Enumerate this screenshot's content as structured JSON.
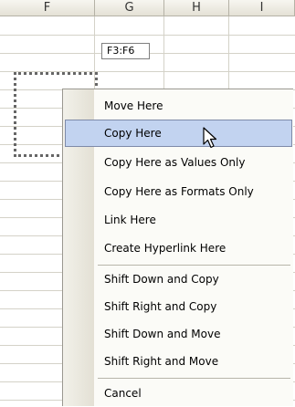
{
  "columns": [
    "F",
    "G",
    "H",
    "I"
  ],
  "tooltip": "F3:F6",
  "menu": {
    "items": [
      {
        "label": "Move Here",
        "hover": false
      },
      {
        "label": "Copy Here",
        "hover": true
      },
      {
        "label": "Copy Here as Values Only",
        "hover": false
      },
      {
        "label": "Copy Here as Formats Only",
        "hover": false
      },
      {
        "label": "Link Here",
        "hover": false
      },
      {
        "label": "Create Hyperlink Here",
        "hover": false
      },
      {
        "label": "Shift Down and Copy",
        "hover": false
      },
      {
        "label": "Shift Right and Copy",
        "hover": false
      },
      {
        "label": "Shift Down and Move",
        "hover": false
      },
      {
        "label": "Shift Right and Move",
        "hover": false
      },
      {
        "label": "Cancel",
        "hover": false
      }
    ]
  }
}
